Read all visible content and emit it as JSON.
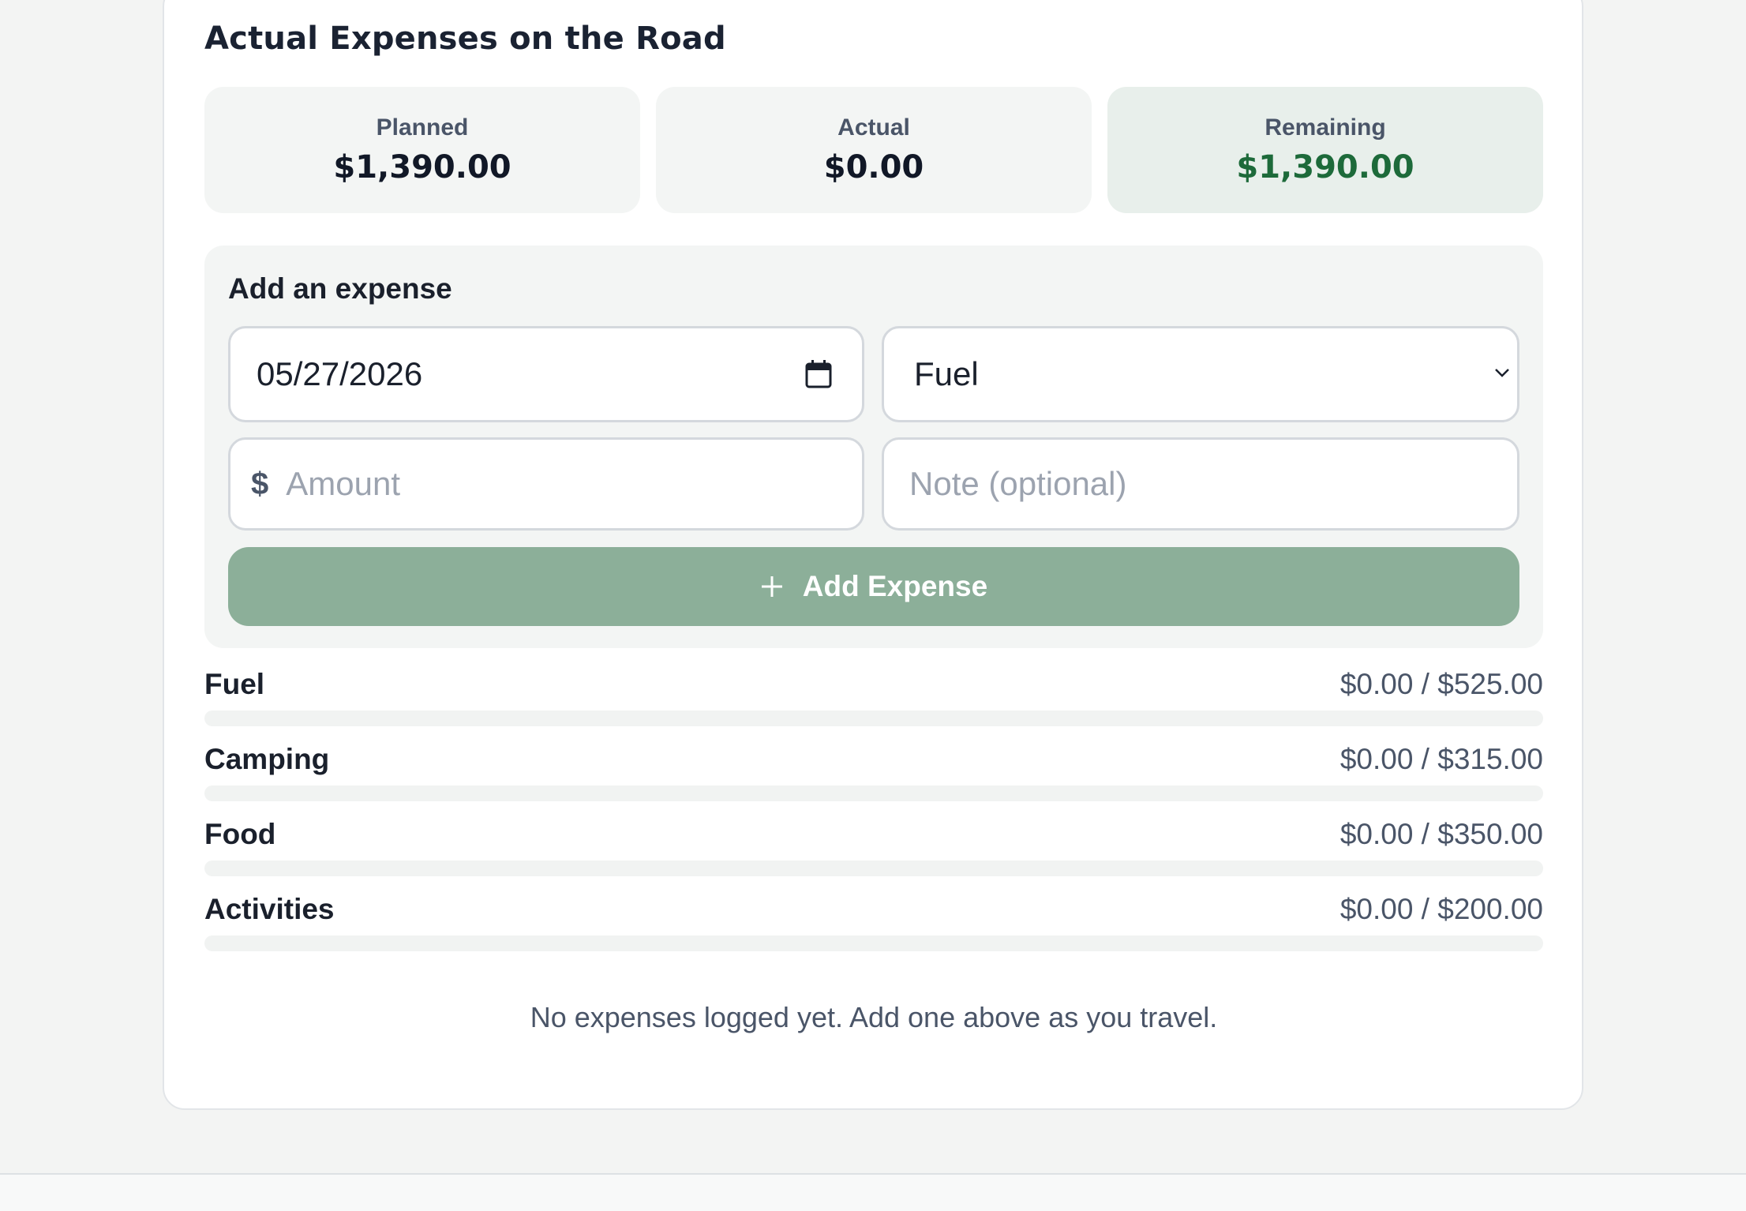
{
  "section": {
    "title": "Actual Expenses on the Road"
  },
  "summary": {
    "planned_label": "Planned",
    "planned_value": "$1,390.00",
    "actual_label": "Actual",
    "actual_value": "$0.00",
    "remaining_label": "Remaining",
    "remaining_value": "$1,390.00",
    "remaining_color": "#1d6a3a"
  },
  "form": {
    "title": "Add an expense",
    "date_value": "05/27/2026",
    "category_selected": "Fuel",
    "currency_symbol": "$",
    "amount_placeholder": "Amount",
    "note_placeholder": "Note (optional)",
    "add_button_label": "Add Expense",
    "button_color": "#8caf99"
  },
  "categories": [
    {
      "name": "Fuel",
      "amount": "$0.00 / $525.00",
      "progress": 0
    },
    {
      "name": "Camping",
      "amount": "$0.00 / $315.00",
      "progress": 0
    },
    {
      "name": "Food",
      "amount": "$0.00 / $350.00",
      "progress": 0
    },
    {
      "name": "Activities",
      "amount": "$0.00 / $200.00",
      "progress": 0
    }
  ],
  "empty_message": "No expenses logged yet. Add one above as you travel.",
  "icons": {
    "date": "calendar-icon",
    "select": "chevron-down-icon",
    "add": "plus-icon"
  }
}
